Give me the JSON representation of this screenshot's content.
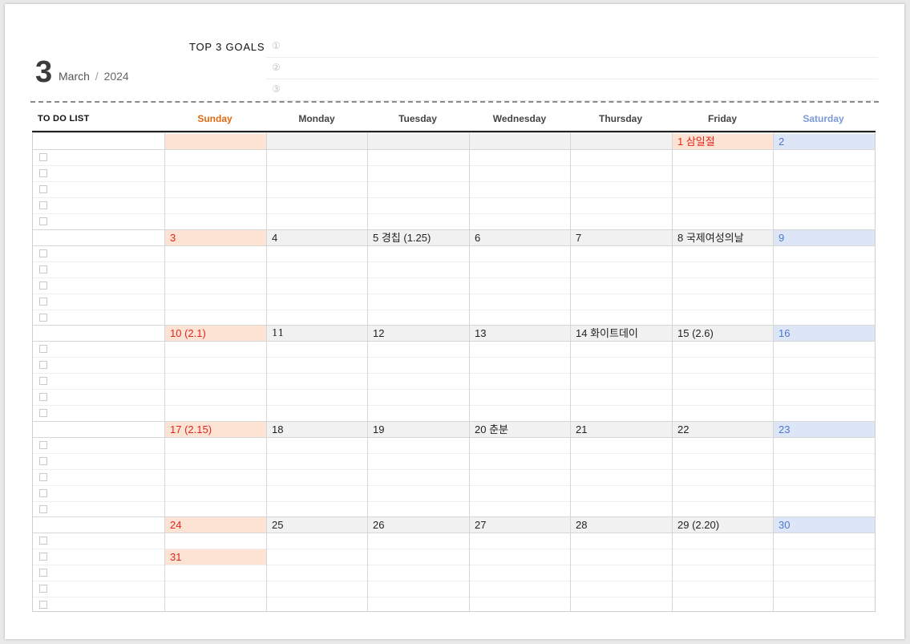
{
  "header": {
    "month_number": "3",
    "month_name": "March",
    "separator": "/",
    "year": "2024",
    "goals_title": "TOP 3 GOALS",
    "goal_markers": [
      "①",
      "②",
      "③"
    ]
  },
  "columns": {
    "todo_label": "TO DO LIST",
    "days": [
      "Sunday",
      "Monday",
      "Tuesday",
      "Wednesday",
      "Thursday",
      "Friday",
      "Saturday"
    ]
  },
  "colors": {
    "sunday": "#e06a10",
    "saturday": "#7b98d8",
    "holiday_red": "#e3251f",
    "saturday_number": "#4f78c8",
    "sunday_bg": "#fde3d4",
    "saturday_bg": "#dde6f7",
    "weekday_bg": "#f1f1f1"
  },
  "weeks": [
    {
      "days": [
        "",
        "",
        "",
        "",
        "",
        "1 삼일절",
        "2"
      ]
    },
    {
      "days": [
        "3",
        "4",
        "5 경칩 (1.25)",
        "6",
        "7",
        "8 국제여성의날",
        "9"
      ]
    },
    {
      "days": [
        "10 (2.1)",
        "11",
        "12",
        "13",
        "14 화이트데이",
        "15 (2.6)",
        "16"
      ]
    },
    {
      "days": [
        "17 (2.15)",
        "18",
        "19",
        "20 춘분",
        "21",
        "22",
        "23"
      ]
    },
    {
      "days": [
        "24",
        "25",
        "26",
        "27",
        "28",
        "29 (2.20)",
        "30"
      ],
      "extra": "31"
    }
  ]
}
